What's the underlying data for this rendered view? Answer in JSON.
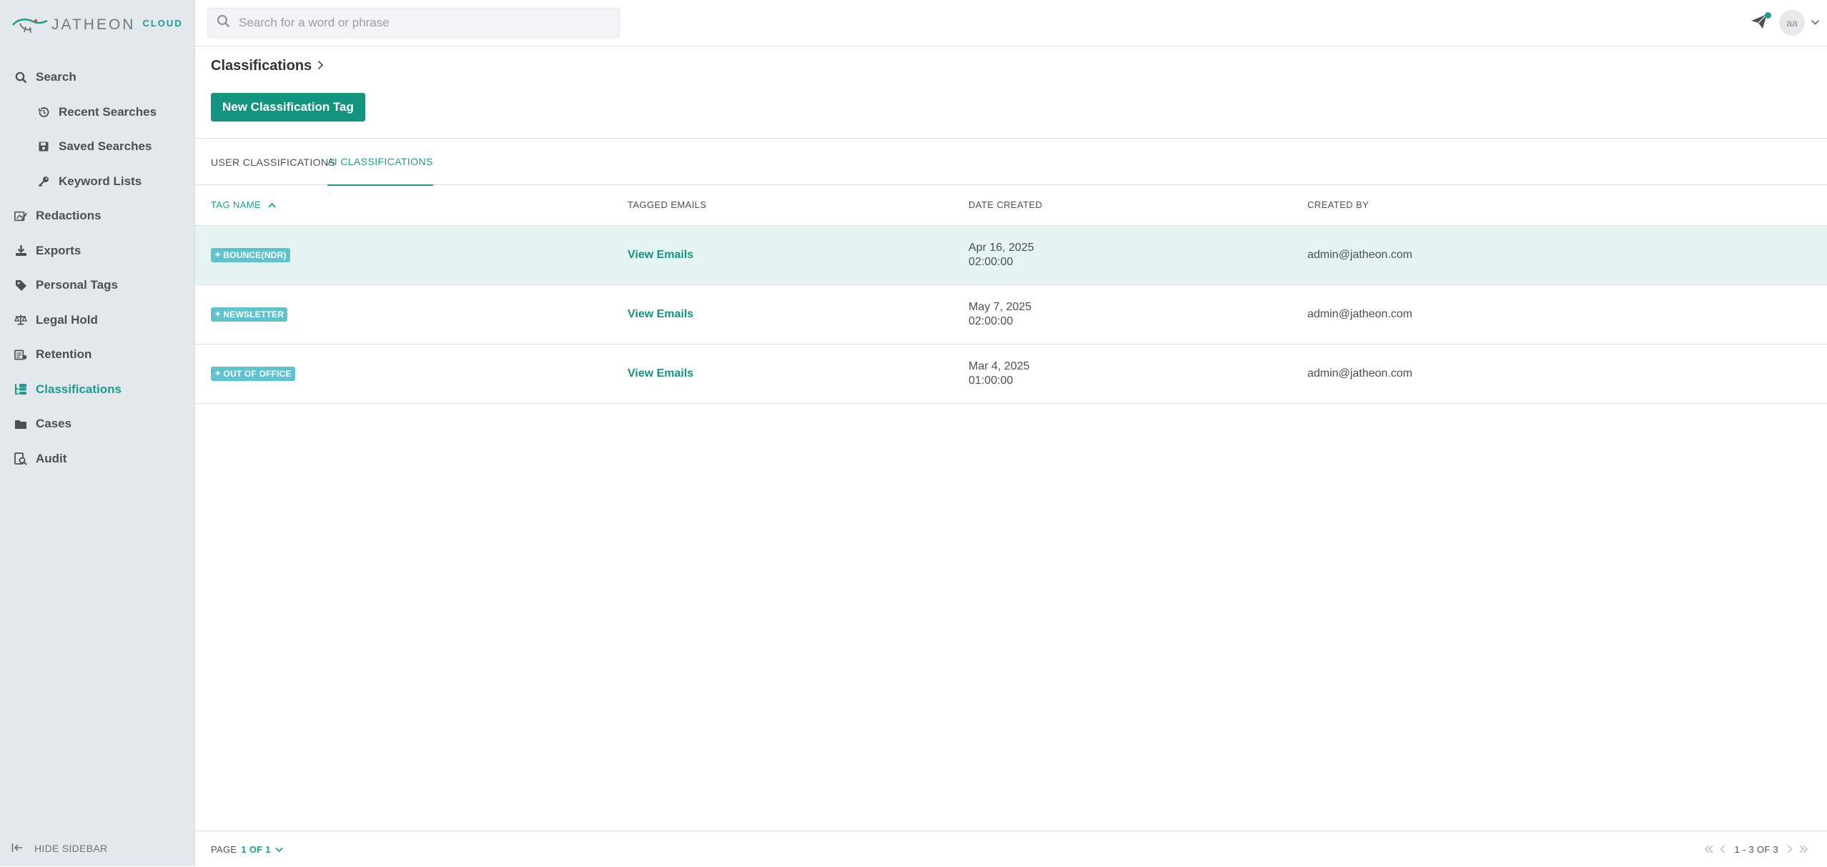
{
  "app": {
    "logo_text": "JATHEON",
    "logo_suffix": "CLOUD"
  },
  "sidebar": {
    "items": [
      {
        "label": "Search",
        "icon": "search-icon"
      },
      {
        "label": "Recent Searches",
        "icon": "history-icon"
      },
      {
        "label": "Saved Searches",
        "icon": "save-icon"
      },
      {
        "label": "Keyword Lists",
        "icon": "key-icon"
      },
      {
        "label": "Redactions",
        "icon": "redaction-icon"
      },
      {
        "label": "Exports",
        "icon": "download-icon"
      },
      {
        "label": "Personal Tags",
        "icon": "tag-icon"
      },
      {
        "label": "Legal Hold",
        "icon": "scale-icon"
      },
      {
        "label": "Retention",
        "icon": "retention-icon"
      },
      {
        "label": "Classifications",
        "icon": "classifications-icon",
        "active": true
      },
      {
        "label": "Cases",
        "icon": "folder-icon"
      },
      {
        "label": "Audit",
        "icon": "audit-icon"
      }
    ],
    "hide_label": "HIDE SIDEBAR"
  },
  "topbar": {
    "search_placeholder": "Search for a word or phrase",
    "avatar_initials": "aa"
  },
  "main": {
    "breadcrumb": "Classifications",
    "new_button": "New Classification Tag",
    "tabs": [
      {
        "label": "USER CLASSIFICATIONS",
        "active": false
      },
      {
        "label": "AI CLASSIFICATIONS",
        "active": true
      }
    ],
    "columns": [
      "TAG NAME",
      "TAGGED EMAILS",
      "DATE CREATED",
      "CREATED BY"
    ],
    "rows": [
      {
        "tag": "BOUNCE(NDR)",
        "link": "View Emails",
        "date": "Apr 16, 2025",
        "time": "02:00:00",
        "created_by": "admin@jatheon.com"
      },
      {
        "tag": "NEWSLETTER",
        "link": "View Emails",
        "date": "May 7, 2025",
        "time": "02:00:00",
        "created_by": "admin@jatheon.com"
      },
      {
        "tag": "OUT OF OFFICE",
        "link": "View Emails",
        "date": "Mar 4, 2025",
        "time": "01:00:00",
        "created_by": "admin@jatheon.com"
      }
    ]
  },
  "footer": {
    "page_label": "PAGE",
    "page_value": "1 OF 1",
    "range": "1 - 3 OF 3"
  },
  "colors": {
    "accent": "#13947f",
    "badge": "#5fc3cf",
    "highlight_row": "#e6f5f3"
  }
}
